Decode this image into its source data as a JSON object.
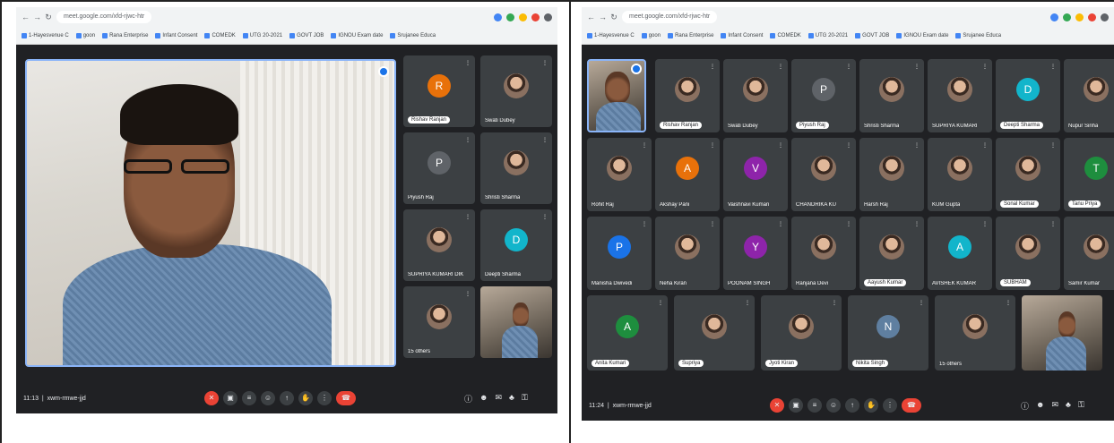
{
  "left_screenshot": {
    "browser": {
      "url": "meet.google.com/xfd-rjwc-htr",
      "bookmarks": [
        "1-Hayesvenue C",
        "goon",
        "Rana Enterprise",
        "Infant Consent",
        "COMEDK",
        "UTG 20-2021",
        "GOVT JOB",
        "IGNOU Exam date",
        "Srujanee Educa"
      ]
    },
    "main_speaker": {
      "pin_badge": "D"
    },
    "participants": [
      {
        "initial": "R",
        "name": "Rishav Ranjan",
        "color": "#e8710a",
        "pill": true,
        "kind": "avatar"
      },
      {
        "initial": "",
        "name": "Swati Dubey",
        "color": "",
        "pill": false,
        "kind": "photo"
      },
      {
        "initial": "P",
        "name": "Piyush Raj",
        "color": "#5f6368",
        "pill": false,
        "kind": "avatar"
      },
      {
        "initial": "",
        "name": "Shristi Sharma",
        "color": "",
        "pill": false,
        "kind": "photo"
      },
      {
        "initial": "",
        "name": "SUPRIYA KUMARI DIK",
        "color": "",
        "pill": false,
        "kind": "photo"
      },
      {
        "initial": "D",
        "name": "Deepti Sharma",
        "color": "#12b5cb",
        "pill": false,
        "kind": "avatar"
      },
      {
        "initial": "",
        "name": "15 others",
        "color": "",
        "pill": false,
        "kind": "photo"
      },
      {
        "initial": "",
        "name": "",
        "color": "",
        "pill": false,
        "kind": "video"
      }
    ],
    "bottom_bar": {
      "time": "11:13",
      "meeting_code": "xwm-rmwe-jjd"
    }
  },
  "right_screenshot": {
    "browser": {
      "url": "meet.google.com/xfd-rjwc-htr",
      "bookmarks": [
        "1-Hayesvenue C",
        "goon",
        "Rana Enterprise",
        "Infant Consent",
        "COMEDK",
        "UTG 20-2021",
        "GOVT JOB",
        "IGNOU Exam date",
        "Srujanee Educa"
      ]
    },
    "self_tile": {
      "pin_badge": "D"
    },
    "participants": [
      {
        "initial": "",
        "name": "Rishav Ranjan",
        "color": "",
        "pill": true,
        "kind": "photo"
      },
      {
        "initial": "",
        "name": "Swati Dubey",
        "color": "",
        "pill": false,
        "kind": "photo"
      },
      {
        "initial": "P",
        "name": "Piyush Raj",
        "color": "#5f6368",
        "pill": true,
        "kind": "avatar"
      },
      {
        "initial": "",
        "name": "Shristi Sharma",
        "color": "",
        "pill": false,
        "kind": "photo"
      },
      {
        "initial": "",
        "name": "SUPRIYA KUMARI",
        "color": "",
        "pill": false,
        "kind": "photo"
      },
      {
        "initial": "D",
        "name": "Deepti Sharma",
        "color": "#12b5cb",
        "pill": true,
        "kind": "avatar"
      },
      {
        "initial": "",
        "name": "Nupur Sinha",
        "color": "",
        "pill": false,
        "kind": "photo"
      },
      {
        "initial": "",
        "name": "Rohit Raj",
        "color": "",
        "pill": false,
        "kind": "photo"
      },
      {
        "initial": "A",
        "name": "Akshay Pani",
        "color": "#e8710a",
        "pill": false,
        "kind": "avatar"
      },
      {
        "initial": "V",
        "name": "Vaishnavi Kumari",
        "color": "#8e24aa",
        "pill": false,
        "kind": "avatar"
      },
      {
        "initial": "",
        "name": "CHANDRIKA KU",
        "color": "",
        "pill": false,
        "kind": "photo"
      },
      {
        "initial": "",
        "name": "Harsh Raj",
        "color": "",
        "pill": false,
        "kind": "photo"
      },
      {
        "initial": "",
        "name": "KUM Gupta",
        "color": "",
        "pill": false,
        "kind": "photo"
      },
      {
        "initial": "",
        "name": "Sonal Kumar",
        "color": "",
        "pill": true,
        "kind": "photo"
      },
      {
        "initial": "T",
        "name": "Tanu Priya",
        "color": "#1e8e3e",
        "pill": true,
        "kind": "avatar"
      },
      {
        "initial": "P",
        "name": "Manisha Dwivedi",
        "color": "#1a73e8",
        "pill": false,
        "kind": "avatar"
      },
      {
        "initial": "",
        "name": "Neha Kiran",
        "color": "",
        "pill": false,
        "kind": "photo"
      },
      {
        "initial": "Y",
        "name": "POONAM SINGH",
        "color": "#8e24aa",
        "pill": false,
        "kind": "avatar"
      },
      {
        "initial": "",
        "name": "Ranjana Devi",
        "color": "",
        "pill": false,
        "kind": "photo"
      },
      {
        "initial": "",
        "name": "Aayush Kumar",
        "color": "",
        "pill": true,
        "kind": "photo"
      },
      {
        "initial": "A",
        "name": "AVISHEK KUMAR",
        "color": "#12b5cb",
        "pill": false,
        "kind": "avatar"
      },
      {
        "initial": "",
        "name": "SUBHAM",
        "color": "",
        "pill": true,
        "kind": "photo"
      },
      {
        "initial": "",
        "name": "Samir Kumar",
        "color": "",
        "pill": false,
        "kind": "photo"
      },
      {
        "initial": "A",
        "name": "Anita Kumari",
        "color": "#1e8e3e",
        "pill": true,
        "kind": "avatar"
      },
      {
        "initial": "",
        "name": "Supriya",
        "color": "",
        "pill": true,
        "kind": "photo"
      },
      {
        "initial": "",
        "name": "Jyoti Kiran",
        "color": "",
        "pill": true,
        "kind": "photo"
      },
      {
        "initial": "N",
        "name": "Nikita Singh",
        "color": "#5f7fa0",
        "pill": true,
        "kind": "avatar"
      },
      {
        "initial": "",
        "name": "15 others",
        "color": "",
        "pill": false,
        "kind": "photo"
      },
      {
        "initial": "",
        "name": "",
        "color": "",
        "pill": false,
        "kind": "video"
      }
    ],
    "bottom_bar": {
      "time": "11:24",
      "meeting_code": "xwm-rmwe-jjd"
    }
  },
  "colors": {
    "meet_bg": "#202124",
    "tile_bg": "#3c4043",
    "accent_blue": "#8ab4f8",
    "end_call_red": "#ea4335"
  }
}
